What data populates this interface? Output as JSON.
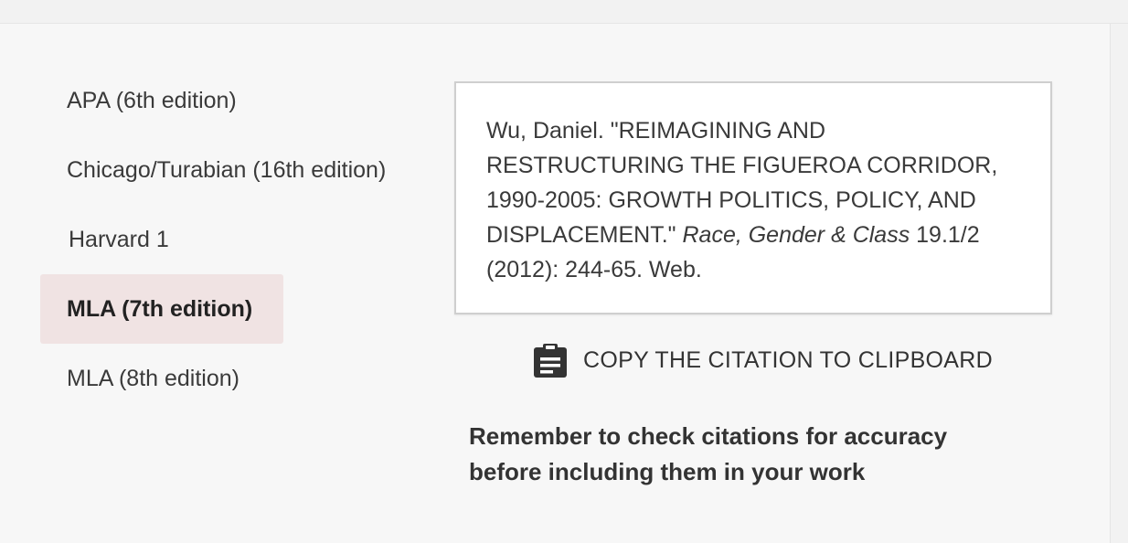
{
  "citation_styles": [
    {
      "label": "APA (6th edition)",
      "selected": false
    },
    {
      "label": "Chicago/Turabian (16th edition)",
      "selected": false
    },
    {
      "label": "Harvard 1",
      "selected": false
    },
    {
      "label": "MLA (7th edition)",
      "selected": true
    },
    {
      "label": "MLA (8th edition)",
      "selected": false
    }
  ],
  "citation": {
    "text_before": "Wu, Daniel. \"REIMAGINING AND RESTRUCTURING THE FIGUEROA CORRIDOR, 1990-2005: GROWTH POLITICS, POLICY, AND DISPLACEMENT.\" ",
    "journal": "Race, Gender & Class",
    "text_after": " 19.1/2 (2012): 244-65. Web."
  },
  "copy_button": {
    "label": "COPY THE CITATION TO CLIPBOARD",
    "icon": "clipboard-icon"
  },
  "reminder": "Remember to check citations for accuracy before including them in your work",
  "colors": {
    "selected_background": "#f0e3e3",
    "panel_background": "#f7f7f7",
    "text": "#333333"
  }
}
